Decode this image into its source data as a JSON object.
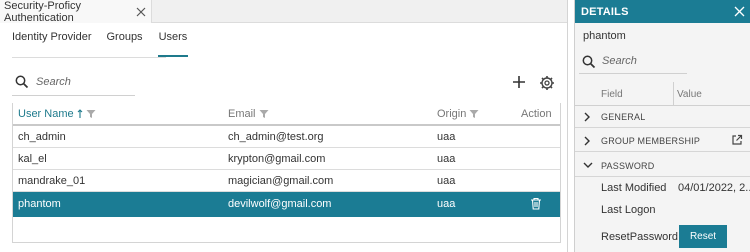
{
  "window": {
    "tab_title": "Security-Proficy Authentication"
  },
  "subtabs": [
    {
      "label": "Identity Provider"
    },
    {
      "label": "Groups"
    },
    {
      "label": "Users",
      "active": true
    }
  ],
  "search": {
    "placeholder": "Search"
  },
  "table": {
    "columns": [
      {
        "label": "User Name",
        "sorted": "ascending",
        "filter": true
      },
      {
        "label": "Email",
        "filter": true
      },
      {
        "label": "Origin",
        "filter": true
      },
      {
        "label": "Action"
      }
    ],
    "rows": [
      {
        "user": "ch_admin",
        "email": "ch_admin@test.org",
        "origin": "uaa",
        "selected": false
      },
      {
        "user": "kal_el",
        "email": "krypton@gmail.com",
        "origin": "uaa",
        "selected": false
      },
      {
        "user": "mandrake_01",
        "email": "magician@gmail.com",
        "origin": "uaa",
        "selected": false
      },
      {
        "user": "phantom",
        "email": "devilwolf@gmail.com",
        "origin": "uaa",
        "selected": true
      }
    ]
  },
  "details": {
    "title": "DETAILS",
    "user": "phantom",
    "search_placeholder": "Search",
    "col_field": "Field",
    "col_value": "Value",
    "groups": [
      {
        "label": "GENERAL",
        "expanded": false
      },
      {
        "label": "GROUP MEMBERSHIP",
        "expanded": false
      },
      {
        "label": "PASSWORD",
        "expanded": true
      }
    ],
    "password_fields": [
      {
        "field": "Last Modified",
        "value": "04/01/2022, 2..."
      },
      {
        "field": "Last Logon",
        "value": ""
      },
      {
        "field": "ResetPassword",
        "button": "Reset"
      }
    ]
  },
  "colors": {
    "accent": "#1b7c94",
    "selected_row": "#1b7c94"
  }
}
